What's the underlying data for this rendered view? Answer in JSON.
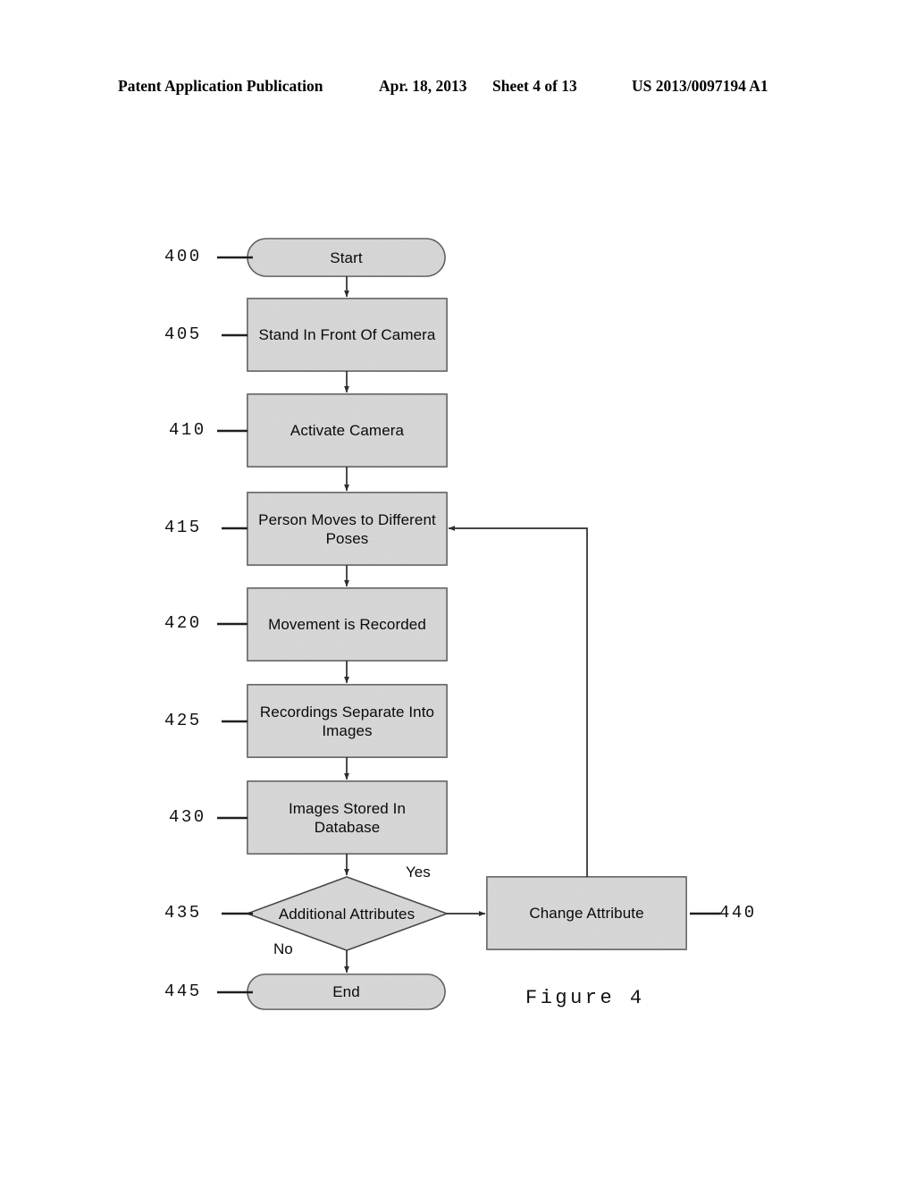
{
  "header": {
    "publication": "Patent Application Publication",
    "date": "Apr. 18, 2013",
    "sheet": "Sheet 4 of 13",
    "patent_number": "US 2013/0097194 A1"
  },
  "figure": {
    "caption": "Figure 4",
    "fill_color": "#e9e9e9",
    "stroke_color": "#4a4a4a",
    "text_color": "#0a0a0a"
  },
  "nodes": [
    {
      "ref": "400",
      "label": "Start",
      "shape": "terminator"
    },
    {
      "ref": "405",
      "label": "Stand In Front Of Camera",
      "shape": "process"
    },
    {
      "ref": "410",
      "label": "Activate Camera",
      "shape": "process"
    },
    {
      "ref": "415",
      "label": "Person Moves to Different\nPoses",
      "shape": "process"
    },
    {
      "ref": "420",
      "label": "Movement is Recorded",
      "shape": "process"
    },
    {
      "ref": "425",
      "label": "Recordings Separate Into\nImages",
      "shape": "process"
    },
    {
      "ref": "430",
      "label": "Images Stored In\nDatabase",
      "shape": "process"
    },
    {
      "ref": "435",
      "label": "Additional Attributes",
      "shape": "decision"
    },
    {
      "ref": "440",
      "label": "Change Attribute",
      "shape": "process"
    },
    {
      "ref": "445",
      "label": "End",
      "shape": "terminator"
    }
  ],
  "branches": {
    "yes": "Yes",
    "no": "No"
  }
}
